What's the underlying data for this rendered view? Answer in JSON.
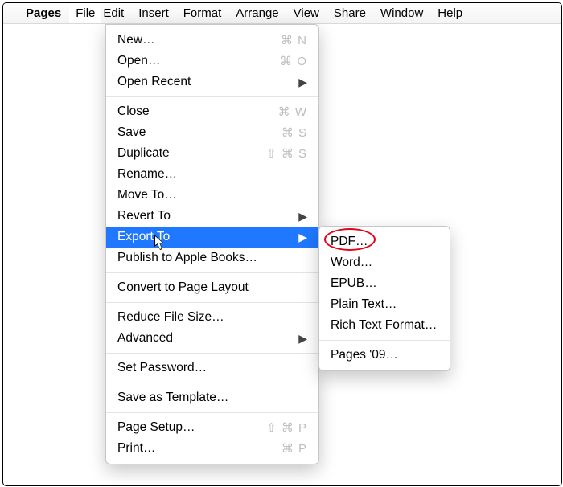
{
  "menubar": {
    "apple": "",
    "items": [
      {
        "label": "Pages",
        "bold": true
      },
      {
        "label": "File",
        "open": true
      },
      {
        "label": "Edit"
      },
      {
        "label": "Insert"
      },
      {
        "label": "Format"
      },
      {
        "label": "Arrange"
      },
      {
        "label": "View"
      },
      {
        "label": "Share"
      },
      {
        "label": "Window"
      },
      {
        "label": "Help"
      }
    ]
  },
  "file_menu": [
    {
      "label": "New…",
      "shortcut": "⌘ N"
    },
    {
      "label": "Open…",
      "shortcut": "⌘ O"
    },
    {
      "label": "Open Recent",
      "submenu": true
    },
    {
      "sep": true
    },
    {
      "label": "Close",
      "shortcut": "⌘ W"
    },
    {
      "label": "Save",
      "shortcut": "⌘ S"
    },
    {
      "label": "Duplicate",
      "shortcut": "⇧ ⌘ S"
    },
    {
      "label": "Rename…"
    },
    {
      "label": "Move To…"
    },
    {
      "label": "Revert To",
      "submenu": true
    },
    {
      "label": "Export To",
      "submenu": true,
      "highlight": true
    },
    {
      "label": "Publish to Apple Books…"
    },
    {
      "sep": true
    },
    {
      "label": "Convert to Page Layout"
    },
    {
      "sep": true
    },
    {
      "label": "Reduce File Size…"
    },
    {
      "label": "Advanced",
      "submenu": true
    },
    {
      "sep": true
    },
    {
      "label": "Set Password…"
    },
    {
      "sep": true
    },
    {
      "label": "Save as Template…"
    },
    {
      "sep": true
    },
    {
      "label": "Page Setup…",
      "shortcut": "⇧ ⌘ P"
    },
    {
      "label": "Print…",
      "shortcut": "⌘ P"
    }
  ],
  "export_submenu": [
    {
      "label": "PDF…",
      "circled": true
    },
    {
      "label": "Word…"
    },
    {
      "label": "EPUB…"
    },
    {
      "label": "Plain Text…"
    },
    {
      "label": "Rich Text Format…"
    },
    {
      "sep": true
    },
    {
      "label": "Pages '09…"
    }
  ]
}
